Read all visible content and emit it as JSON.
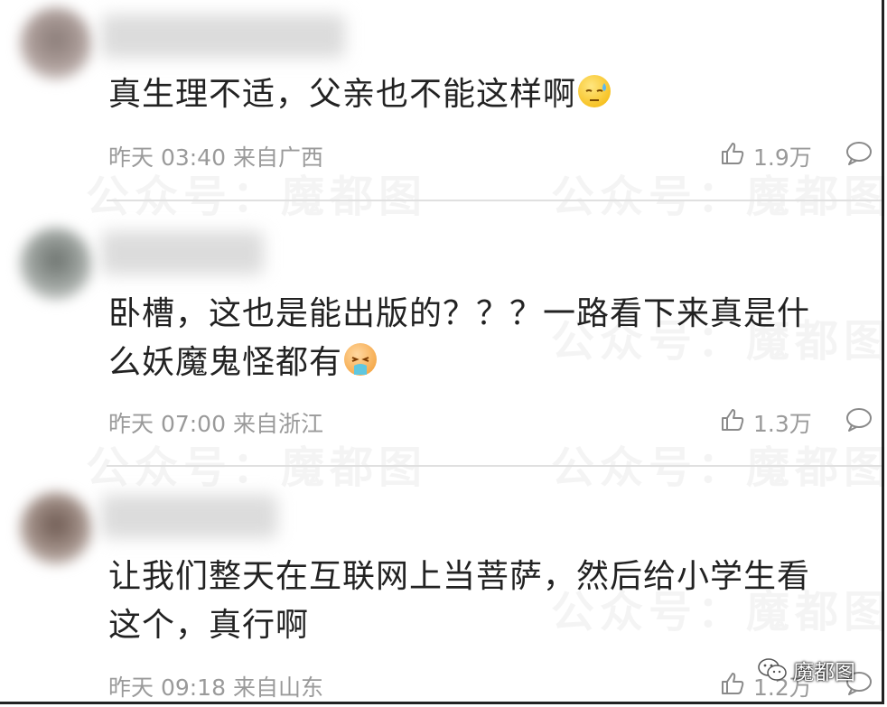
{
  "watermark": "公众号：魔都图",
  "brand": {
    "name": "魔都图"
  },
  "comments": [
    {
      "text": "真生理不适，父亲也不能这样啊",
      "emoji": "sweat-emoji",
      "time": "昨天 03:40",
      "location": "来自广西",
      "likes": "1.9万"
    },
    {
      "text_line1": "卧槽，这也是能出版的？？？一路看下来真是什",
      "text_line2": "么妖魔鬼怪都有",
      "emoji": "vomit-emoji",
      "time": "昨天 07:00",
      "location": "来自浙江",
      "likes": "1.3万"
    },
    {
      "text_line1": "让我们整天在互联网上当菩萨，然后给小学生看",
      "text_line2": "这个，真行啊",
      "time": "昨天 09:18",
      "location": "来自山东",
      "likes": "1.2万"
    }
  ],
  "colors": {
    "text": "#222222",
    "meta": "#9a9a9a",
    "divider": "#e0e0e0"
  }
}
